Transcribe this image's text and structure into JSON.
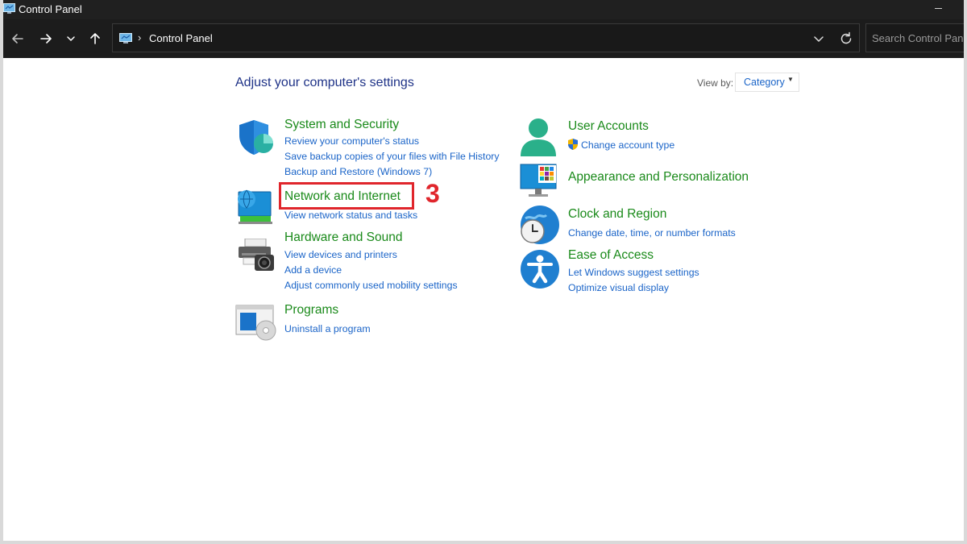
{
  "window": {
    "title": "Control Panel"
  },
  "address_bar": {
    "separator": "›",
    "crumb": "Control Panel"
  },
  "search": {
    "placeholder": "Search Control Panel"
  },
  "content": {
    "heading": "Adjust your computer's settings",
    "view_by_label": "View by:",
    "view_by_value": "Category"
  },
  "categories": {
    "system_security": {
      "title": "System and Security",
      "links": [
        "Review your computer's status",
        "Save backup copies of your files with File History",
        "Backup and Restore (Windows 7)"
      ]
    },
    "network_internet": {
      "title": "Network and Internet",
      "links": [
        "View network status and tasks"
      ]
    },
    "hardware_sound": {
      "title": "Hardware and Sound",
      "links": [
        "View devices and printers",
        "Add a device",
        "Adjust commonly used mobility settings"
      ]
    },
    "programs": {
      "title": "Programs",
      "links": [
        "Uninstall a program"
      ]
    },
    "user_accounts": {
      "title": "User Accounts",
      "links": [
        "Change account type"
      ]
    },
    "appearance": {
      "title": "Appearance and Personalization",
      "links": []
    },
    "clock_region": {
      "title": "Clock and Region",
      "links": [
        "Change date, time, or number formats"
      ]
    },
    "ease_access": {
      "title": "Ease of Access",
      "links": [
        "Let Windows suggest settings",
        "Optimize visual display"
      ]
    }
  },
  "annotation": {
    "step_number": "3",
    "color": "#e0262c"
  },
  "colors": {
    "category_title": "#1a8a1a",
    "link": "#1a64c8",
    "heading": "#1e3287",
    "titlebar_bg": "#202020"
  }
}
